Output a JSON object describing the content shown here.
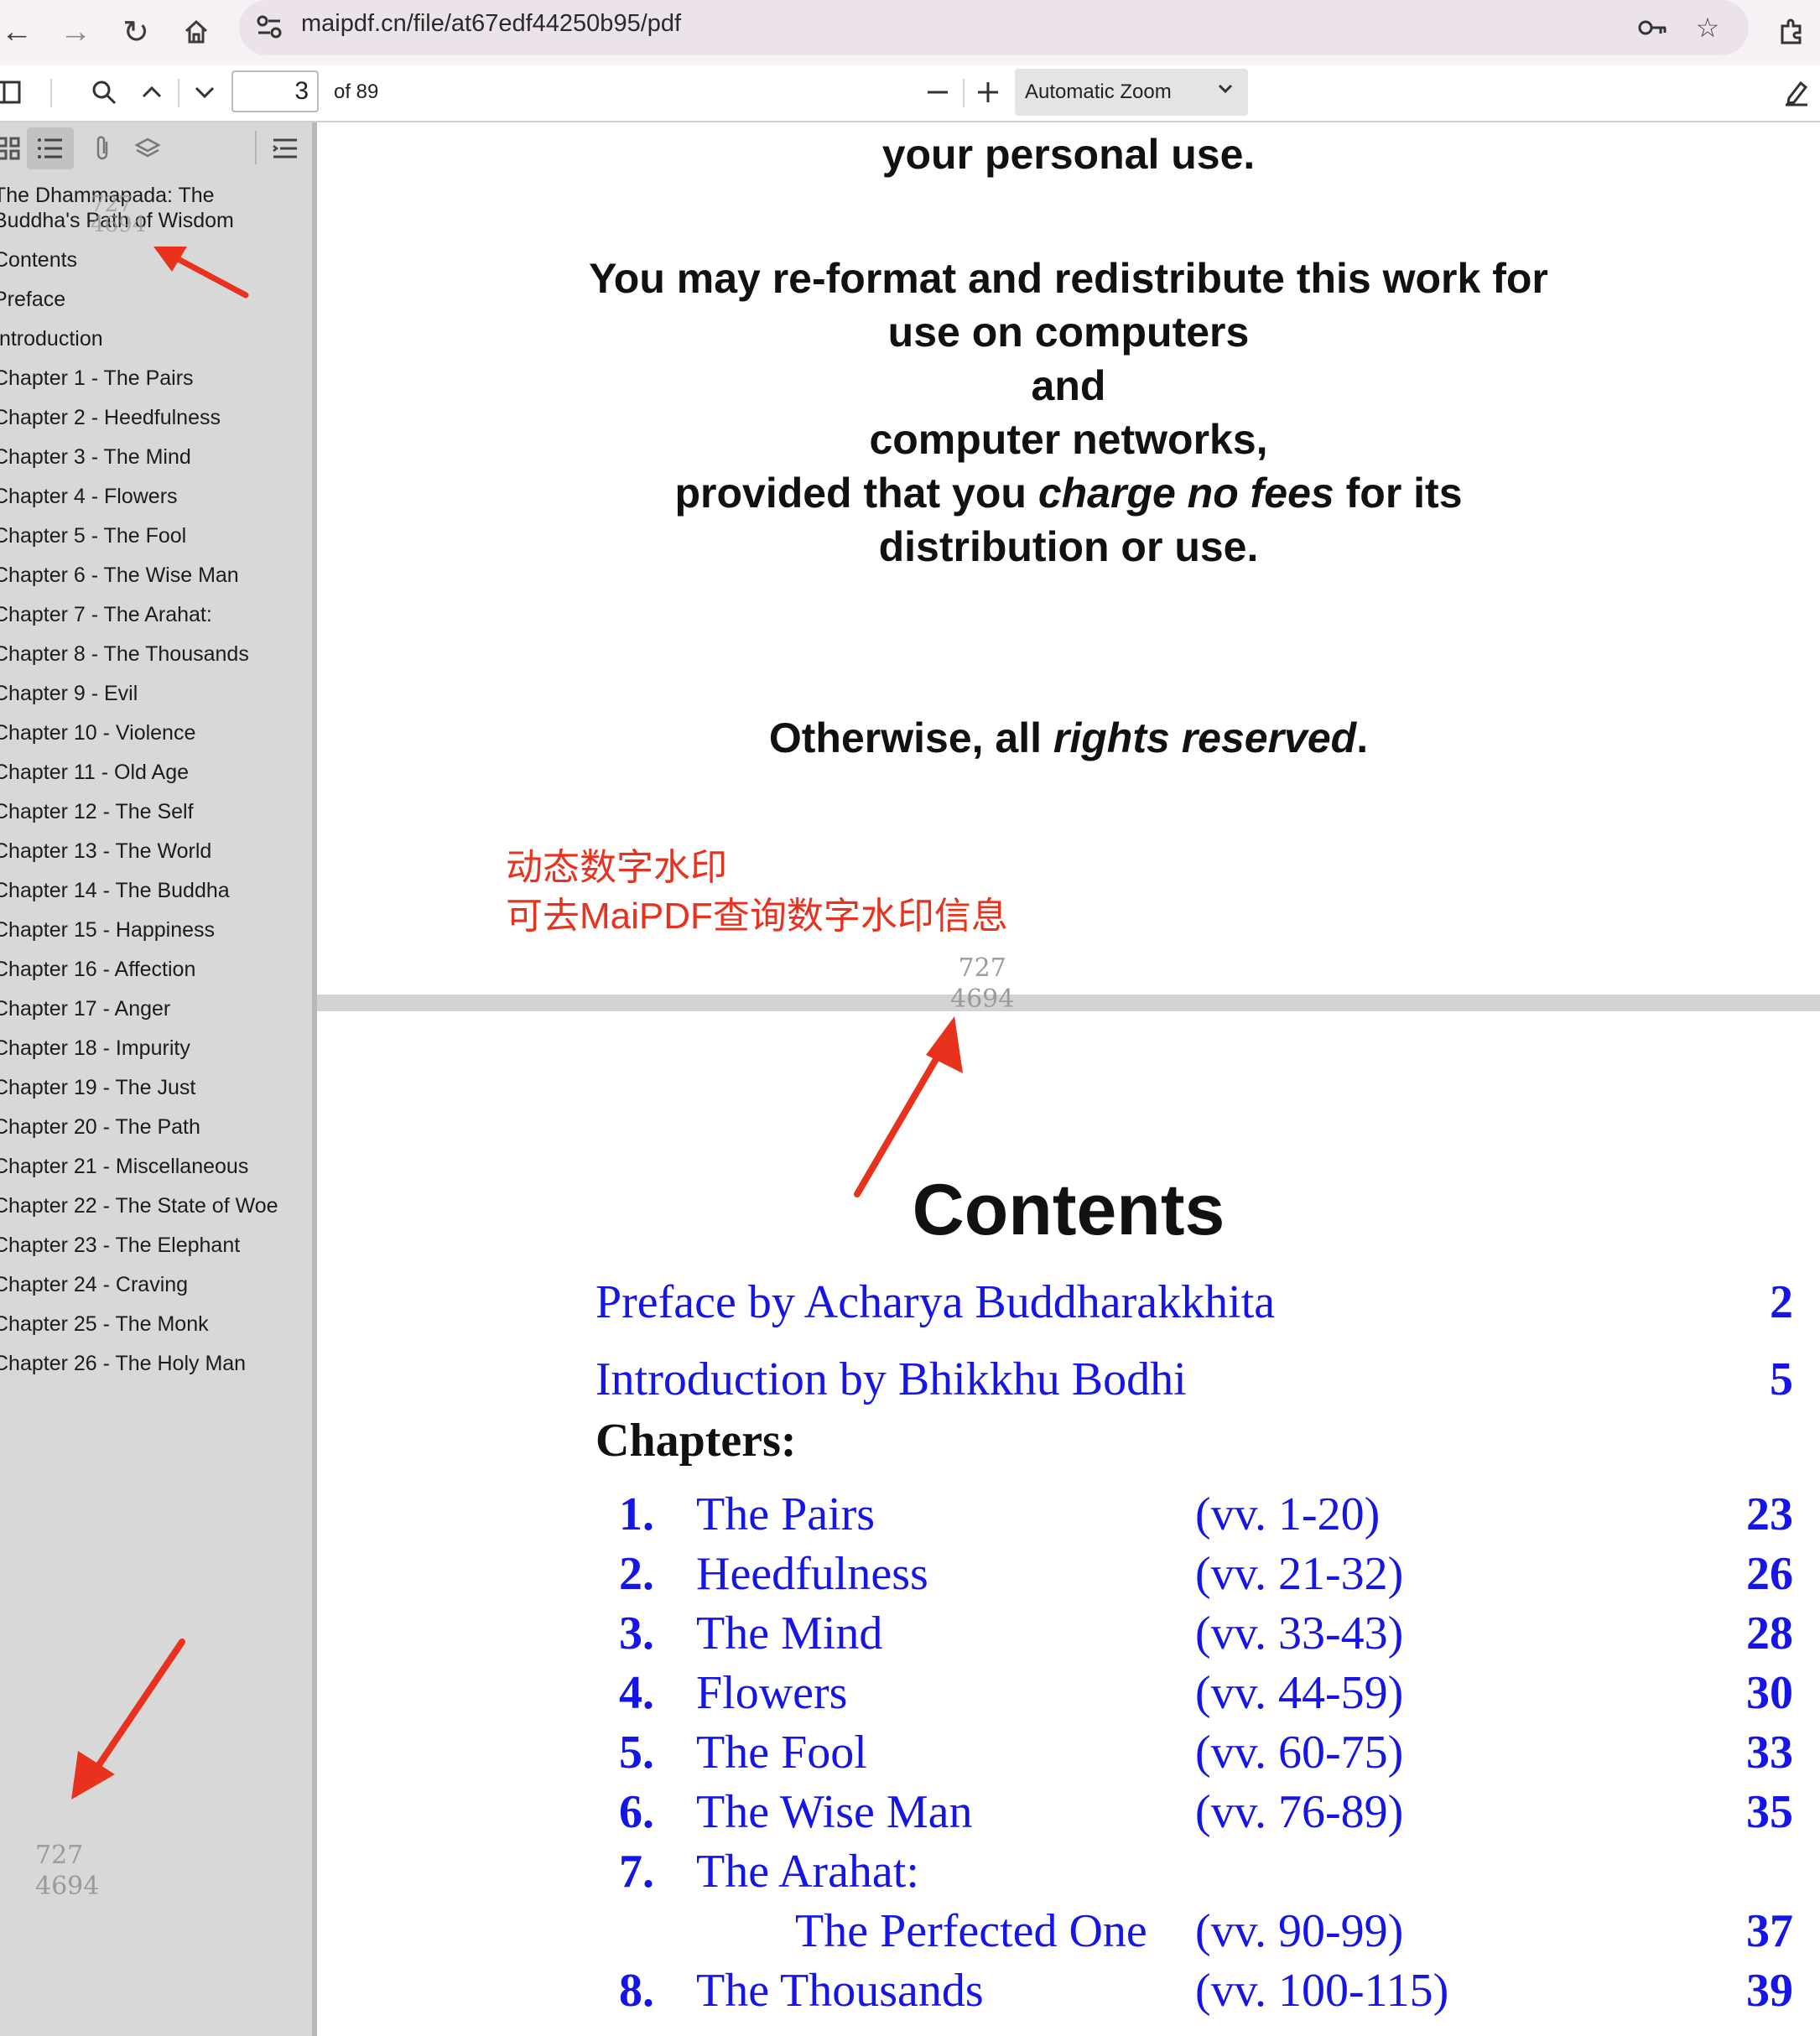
{
  "browser": {
    "url": "maipdf.cn/file/at67edf44250b95/pdf"
  },
  "toolbar": {
    "page_number": "3",
    "page_total": "of 89",
    "zoom_label": "Automatic Zoom"
  },
  "sidebar": {
    "outline": [
      "The Dhammapada: The",
      "Buddha's Path of Wisdom",
      "Contents",
      "Preface",
      "Introduction",
      "Chapter 1 - The Pairs",
      "Chapter 2 - Heedfulness",
      "Chapter 3 - The Mind",
      "Chapter 4 - Flowers",
      "Chapter 5 - The Fool",
      "Chapter 6 - The Wise Man",
      "Chapter 7 - The Arahat:",
      "Chapter 8 - The Thousands",
      "Chapter 9 - Evil",
      "Chapter 10 - Violence",
      "Chapter 11 - Old Age",
      "Chapter 12 - The Self",
      "Chapter 13 - The World",
      "Chapter 14 - The Buddha",
      "Chapter 15 - Happiness",
      "Chapter 16 - Affection",
      "Chapter 17 - Anger",
      "Chapter 18 - Impurity",
      "Chapter 19 - The Just",
      "Chapter 20 - The Path",
      "Chapter 21 - Miscellaneous",
      "Chapter 22 - The State of Woe",
      "Chapter 23 - The Elephant",
      "Chapter 24 - Craving",
      "Chapter 25 - The Monk",
      "Chapter 26 - The Holy Man"
    ],
    "watermark_top": [
      "727",
      "4694"
    ],
    "watermark_bottom": [
      "727",
      "4694"
    ]
  },
  "page2": {
    "line_1": "your personal use.",
    "line_2": "You may re-format and redistribute this work for",
    "line_3": "use on computers",
    "line_4": "and",
    "line_5": "computer networks,",
    "line_6_a": "provided that you ",
    "line_6_b": "charge no fees",
    "line_6_c": " for its",
    "line_7": "distribution or use.",
    "line_8_a": "Otherwise, all ",
    "line_8_b": "rights reserved",
    "line_8_c": "."
  },
  "watermark_note": {
    "line_1": "动态数字水印",
    "line_2": "可去MaiPDF查询数字水印信息"
  },
  "page_watermark": [
    "727",
    "4694"
  ],
  "page3": {
    "title": "Contents",
    "preface": {
      "label": "Preface by Acharya Buddharakkhita",
      "page": "2"
    },
    "introduction": {
      "label": "Introduction by Bhikkhu Bodhi",
      "page": "5"
    },
    "chapters_label": "Chapters:",
    "chapters": [
      {
        "num": "1.",
        "title": "The Pairs",
        "verses": "(vv. 1-20)",
        "page": "23"
      },
      {
        "num": "2.",
        "title": "Heedfulness",
        "verses": "(vv. 21-32)",
        "page": "26"
      },
      {
        "num": "3.",
        "title": "The Mind",
        "verses": "(vv. 33-43)",
        "page": "28"
      },
      {
        "num": "4.",
        "title": "Flowers",
        "verses": "(vv. 44-59)",
        "page": "30"
      },
      {
        "num": "5.",
        "title": "The Fool",
        "verses": "(vv. 60-75)",
        "page": "33"
      },
      {
        "num": "6.",
        "title": "The Wise Man",
        "verses": "(vv. 76-89)",
        "page": "35"
      },
      {
        "num": "7.",
        "title": "The Arahat:",
        "verses": "",
        "page": ""
      },
      {
        "num": "",
        "title": "The Perfected One",
        "verses": "(vv. 90-99)",
        "page": "37"
      },
      {
        "num": "8.",
        "title": "The Thousands",
        "verses": "(vv. 100-115)",
        "page": "39"
      }
    ]
  },
  "colors": {
    "link_blue": "#1515e6",
    "annotation_red": "#e8321e",
    "sidebar_bg": "#d8d8d8"
  }
}
